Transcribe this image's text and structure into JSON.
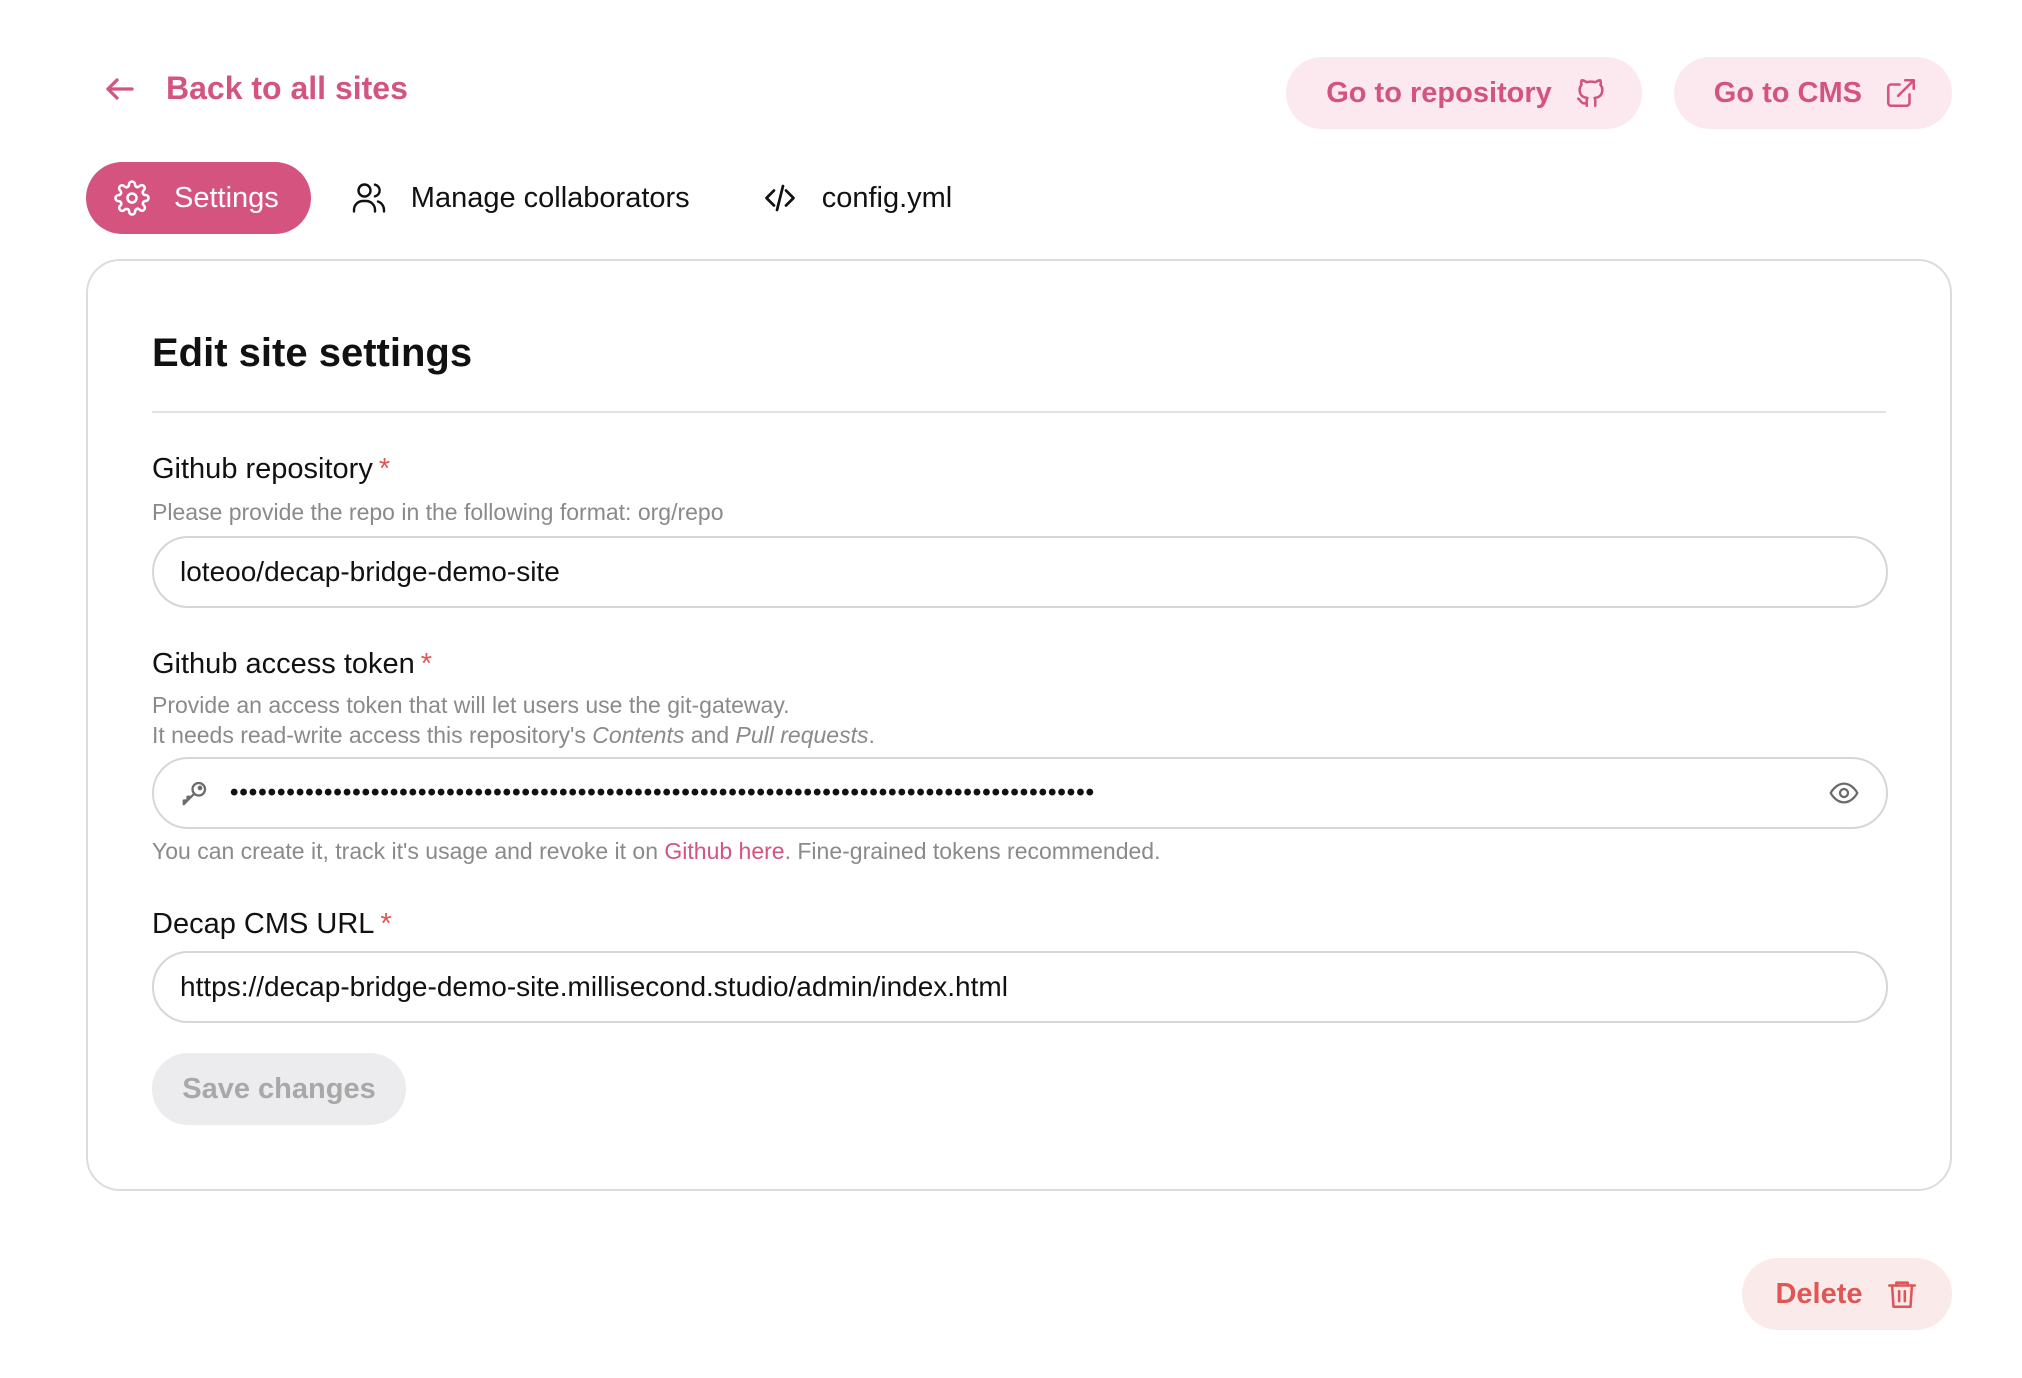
{
  "header": {
    "back_label": "Back to all sites",
    "repo_button": "Go to repository",
    "cms_button": "Go to CMS"
  },
  "tabs": [
    {
      "label": "Settings",
      "icon": "gear-icon",
      "active": true
    },
    {
      "label": "Manage collaborators",
      "icon": "users-icon",
      "active": false
    },
    {
      "label": "config.yml",
      "icon": "code-icon",
      "active": false
    }
  ],
  "card": {
    "title": "Edit site settings",
    "repo": {
      "label": "Github repository",
      "required": "*",
      "help": "Please provide the repo in the following format: org/repo",
      "value": "loteoo/decap-bridge-demo-site"
    },
    "token": {
      "label": "Github access token",
      "required": "*",
      "help_line1": "Provide an access token that will let users use the git-gateway.",
      "help_line2_prefix": "It needs read-write access this repository's ",
      "help_line2_em1": "Contents",
      "help_line2_and": " and ",
      "help_line2_em2": "Pull requests",
      "help_line2_suffix": ".",
      "masked_value": "••••••••••••••••••••••••••••••••••••••••••••••••••••••••••••••••••••••••••••••••••••••••••••",
      "footer_prefix": "You can create it, track it's usage and revoke it on ",
      "footer_link": "Github here",
      "footer_suffix": ". Fine-grained tokens recommended."
    },
    "cms_url": {
      "label": "Decap CMS URL",
      "required": "*",
      "value": "https://decap-bridge-demo-site.millisecond.studio/admin/index.html"
    },
    "save_label": "Save changes"
  },
  "delete_label": "Delete",
  "colors": {
    "accent": "#d4547f",
    "accent_soft": "#fbe9ef",
    "danger": "#e05656",
    "danger_soft": "#fbeaea"
  }
}
